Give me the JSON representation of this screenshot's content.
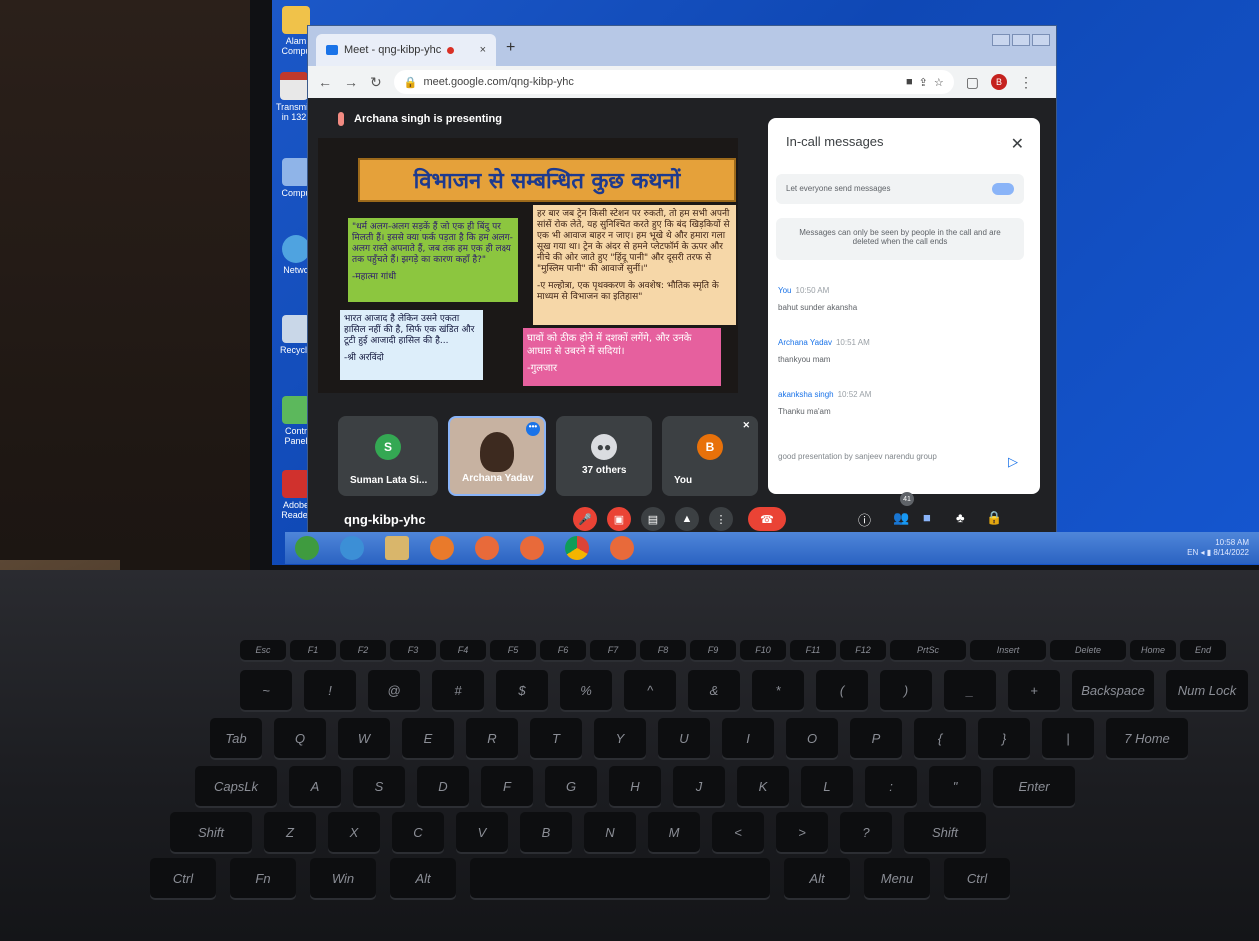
{
  "desktop": {
    "icons": [
      {
        "label": "Alam Compu"
      },
      {
        "label": "Transmis in 132"
      },
      {
        "label": "Compu"
      },
      {
        "label": "Netwo"
      },
      {
        "label": "Recycle"
      },
      {
        "label": "Contr Panel"
      },
      {
        "label": "Adobe Reader"
      }
    ]
  },
  "browser": {
    "tab_title": "Meet - qng-kibp-yhc",
    "url": "meet.google.com/qng-kibp-yhc",
    "profile_initial": "B"
  },
  "meet": {
    "presenter_text": "Archana singh is presenting",
    "slide": {
      "title": "विभाजन से सम्बन्धित कुछ कथनों",
      "quote1": "\"धर्म अलग-अलग सड़कें हैं जो एक ही बिंदु पर मिलती हैं। इससे क्या फर्क पड़ता है कि हम अलग-अलग रास्ते अपनाते हैं, जब तक हम एक ही लक्ष्य तक पहुँचते हैं। झगड़े का कारण कहाँ है?\"",
      "quote1_author": "-महात्मा गांधी",
      "quote2": "हर बार जब ट्रेन किसी स्टेशन पर रुकती, तो हम सभी अपनी सांसें रोक लेते, यह सुनिश्चित करते हुए कि बंद खिड़कियों से एक भी आवाज बाहर न जाए। हम भूखे थे और हमारा गला सूख गया था। ट्रेन के अंदर से हमने प्लेटफॉर्म के ऊपर और नीचे की ओर जाते हुए \"हिंदू पानी\" और दूसरी तरफ से \"मुस्लिम पानी\" की आवाजें सुनीं।\"",
      "quote2_author": "-ए मल्होत्रा, एक पृथक्करण के अवशेष: भौतिक स्मृति के माध्यम से विभाजन का इतिहास\"",
      "quote3": "भारत आजाद है लेकिन उसने एकता हासिल नहीं की है, सिर्फ एक खंडित और टूटी हुई आजादी हासिल की है...",
      "quote3_author": "-श्री अरविंदो",
      "quote4": "घावों को ठीक होने में दशकों लगेंगे, और उनके आघात से उबरने में सदियां।",
      "quote4_author": "-गुलजार"
    },
    "participants": [
      {
        "initial": "S",
        "name": "Suman Lata Si...",
        "color": "#34a853"
      },
      {
        "initial": "",
        "name": "Archana Yadav",
        "color": "#8a6d5a"
      },
      {
        "initial": "",
        "name": "37 others",
        "color": "#5f6368"
      },
      {
        "initial": "B",
        "name": "You",
        "color": "#e8710a"
      }
    ],
    "chat": {
      "title": "In-call messages",
      "toggle_label": "Let everyone send messages",
      "notice": "Messages can only be seen by people in the call and are deleted when the call ends",
      "messages": [
        {
          "sender": "You",
          "time": "10:50 AM",
          "text": "bahut sunder akansha"
        },
        {
          "sender": "Archana Yadav",
          "time": "10:51 AM",
          "text": "thankyou mam"
        },
        {
          "sender": "akanksha singh",
          "time": "10:52 AM",
          "text": "Thanku ma'am"
        }
      ],
      "compose_text": "good presentation by sanjeev narendu group"
    },
    "meeting_code": "qng-kibp-yhc",
    "people_count": "41"
  },
  "taskbar": {
    "tray_time": "10:58 AM",
    "tray_date": "8/14/2022",
    "tray_lang": "EN"
  },
  "keyboard": {
    "row1": [
      "Esc",
      "F1",
      "F2",
      "F3",
      "F4",
      "F5",
      "F6",
      "F7",
      "F8",
      "F9",
      "F10",
      "F11",
      "F12",
      "PrtSc",
      "Insert",
      "Delete",
      "Home",
      "End"
    ],
    "row2": [
      "~",
      "!",
      "@",
      "#",
      "$",
      "%",
      "^",
      "&",
      "*",
      "(",
      ")",
      "_",
      "+",
      "Backspace",
      "Num Lock"
    ],
    "row3": [
      "Tab",
      "Q",
      "W",
      "E",
      "R",
      "T",
      "Y",
      "U",
      "I",
      "O",
      "P",
      "{",
      "}",
      "|",
      "7 Home"
    ],
    "row4": [
      "CapsLk",
      "A",
      "S",
      "D",
      "F",
      "G",
      "H",
      "J",
      "K",
      "L",
      ":",
      "\"",
      "Enter"
    ],
    "row5": [
      "Shift",
      "Z",
      "X",
      "C",
      "V",
      "B",
      "N",
      "M",
      "<",
      ">",
      "?",
      "Shift"
    ],
    "row6": [
      "Ctrl",
      "Fn",
      "Win",
      "Alt",
      "",
      "Alt",
      "Menu",
      "Ctrl"
    ]
  },
  "colors": {
    "desktop_blue": "#1556cf",
    "meet_dark": "#202124",
    "hangup_red": "#ea4335",
    "accent_blue": "#1a73e8"
  }
}
